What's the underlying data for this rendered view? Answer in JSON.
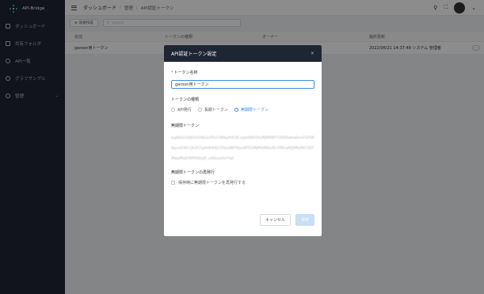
{
  "app": {
    "brand": "API-Bridge"
  },
  "sidebar": {
    "items": [
      {
        "label": "ダッシュボード",
        "icon": "dashboard-icon"
      },
      {
        "label": "共有フォルダ",
        "icon": "folder-icon"
      },
      {
        "label": "API一覧",
        "icon": "cloud-icon"
      },
      {
        "label": "グラフサンプル",
        "icon": "chat-icon"
      },
      {
        "label": "管理",
        "icon": "gear-icon"
      }
    ]
  },
  "header": {
    "breadcrumb": [
      "ダッシュボード",
      "管理",
      "API認証トークン"
    ],
    "separator": "/"
  },
  "toolbar": {
    "new_label": "新規作成",
    "search_placeholder": "Search"
  },
  "table": {
    "columns": [
      "名前",
      "トークンの種類",
      "オーナー",
      "最終更新"
    ],
    "rows": [
      {
        "name": "garoon用トークン",
        "type": "",
        "owner": "",
        "updated": "2022/06/21 14:37:49 システム 管理者"
      }
    ]
  },
  "modal": {
    "title": "API認証トークン設定",
    "close": "×",
    "name_label": "トークン名称",
    "name_value": "garoon用トークン",
    "type_label": "トークンの種類",
    "type_options": [
      "API発行",
      "長期トークン",
      "無期限トークン"
    ],
    "type_selected": "無期限トークン",
    "token_label": "無期限トークン",
    "token_value": "eyJhbGciOiJIUzI1NiIsInR5cCI6IkpXVCJ9.eyJzdWIiOiIxMjM0NTY3ODkwIiwibmFtZSI6IkpvaG4iLCJhZG1pbiI6dHJ1ZSwiaWF0IjoxNTE2MjM5MDIyfQ.SflKxwRJSMeKKF2QT4fwpMeJf36POk6yJV_adQssw5cFlg2",
    "reissue_label": "無期限トークンの再発行",
    "reissue_checkbox": "保存時に無期限トークンを再発行する",
    "cancel_label": "キャンセル",
    "save_label": "保存"
  },
  "colors": {
    "sidebar_bg": "#1f2633",
    "accent": "#3a8ee6",
    "required": "#e74c3c"
  }
}
